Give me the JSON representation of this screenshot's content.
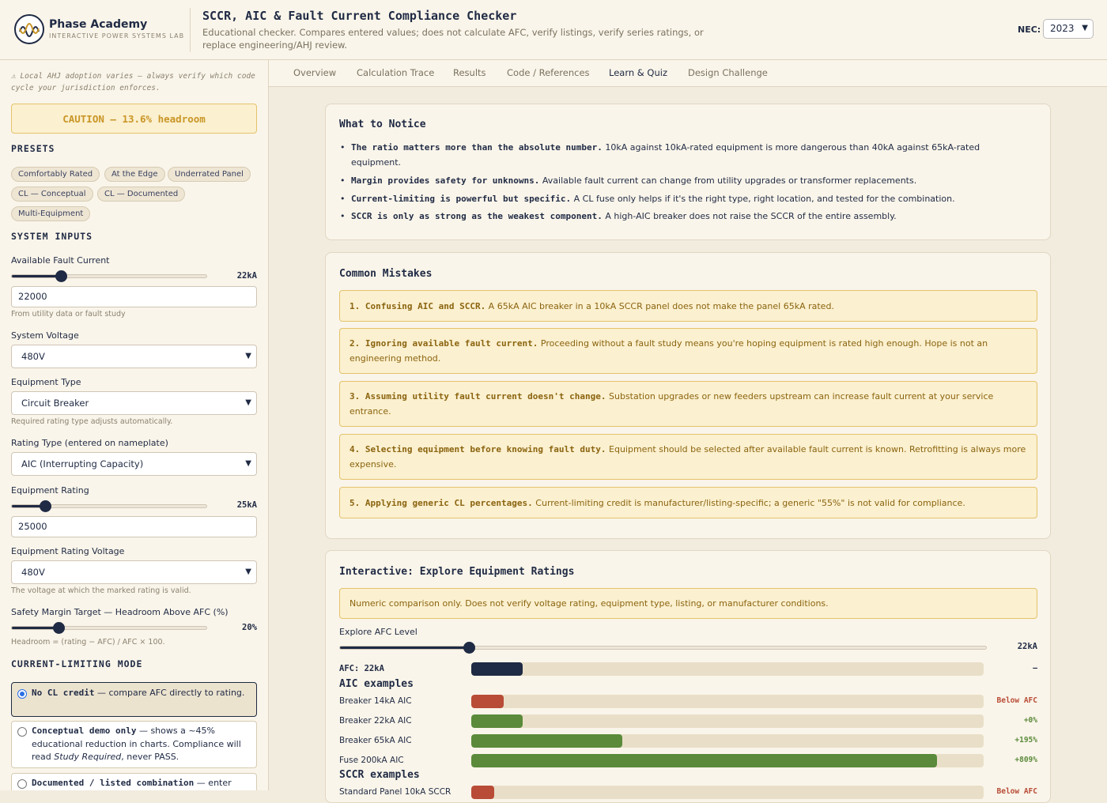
{
  "header": {
    "brand_name": "Phase Academy",
    "brand_sub": "INTERACTIVE POWER SYSTEMS LAB",
    "title": "SCCR, AIC & Fault Current Compliance Checker",
    "description": "Educational checker. Compares entered values; does not calculate AFC, verify listings, verify series ratings, or replace engineering/AHJ review.",
    "nec_label": "NEC:",
    "nec_value": "2023"
  },
  "sidebar": {
    "note": "⚠ Local AHJ adoption varies — always verify which code cycle your jurisdiction enforces.",
    "status": "CAUTION — 13.6% headroom",
    "presets_heading": "PRESETS",
    "presets": [
      "Comfortably Rated",
      "At the Edge",
      "Underrated Panel",
      "CL — Conceptual",
      "CL — Documented",
      "Multi-Equipment"
    ],
    "system_heading": "SYSTEM INPUTS",
    "afc_label": "Available Fault Current",
    "afc_display": "22kA",
    "afc_fraction": 0.25,
    "afc_input": "22000",
    "afc_hint": "From utility data or fault study",
    "voltage_label": "System Voltage",
    "voltage_value": "480V",
    "equip_type_label": "Equipment Type",
    "equip_type_value": "Circuit Breaker",
    "equip_type_hint": "Required rating type adjusts automatically.",
    "rating_type_label": "Rating Type (entered on nameplate)",
    "rating_type_value": "AIC (Interrupting Capacity)",
    "equip_rating_label": "Equipment Rating",
    "equip_rating_display": "25kA",
    "equip_rating_fraction": 0.17,
    "equip_rating_input": "25000",
    "rating_voltage_label": "Equipment Rating Voltage",
    "rating_voltage_value": "480V",
    "rating_voltage_hint": "The voltage at which the marked rating is valid.",
    "margin_label": "Safety Margin Target — Headroom Above AFC (%)",
    "margin_display": "20%",
    "margin_fraction": 0.24,
    "margin_hint": "Headroom = (rating − AFC) / AFC × 100.",
    "cl_heading": "CURRENT-LIMITING MODE",
    "cl_options": [
      {
        "bold": "No CL credit",
        "rest": " — compare AFC directly to rating.",
        "selected": true
      },
      {
        "bold": "Conceptual demo only",
        "rest": " — shows a ~45% educational reduction in charts. Compliance will read ",
        "italic": "Study Required",
        "tail": ", never PASS.",
        "selected": false
      },
      {
        "bold": "Documented / listed combination",
        "rest": " — enter",
        "selected": false
      }
    ]
  },
  "tabs": [
    "Overview",
    "Calculation Trace",
    "Results",
    "Code / References",
    "Learn & Quiz",
    "Design Challenge"
  ],
  "active_tab": "Learn & Quiz",
  "notice": {
    "title": "What to Notice",
    "items": [
      {
        "bold": "The ratio matters more than the absolute number.",
        "text": " 10kA against 10kA-rated equipment is more dangerous than 40kA against 65kA-rated equipment."
      },
      {
        "bold": "Margin provides safety for unknowns.",
        "text": " Available fault current can change from utility upgrades or transformer replacements."
      },
      {
        "bold": "Current-limiting is powerful but specific.",
        "text": " A CL fuse only helps if it's the right type, right location, and tested for the combination."
      },
      {
        "bold": "SCCR is only as strong as the weakest component.",
        "text": " A high-AIC breaker does not raise the SCCR of the entire assembly."
      }
    ]
  },
  "mistakes": {
    "title": "Common Mistakes",
    "items": [
      {
        "bold": "1. Confusing AIC and SCCR.",
        "text": " A 65kA AIC breaker in a 10kA SCCR panel does not make the panel 65kA rated."
      },
      {
        "bold": "2. Ignoring available fault current.",
        "text": " Proceeding without a fault study means you're hoping equipment is rated high enough. Hope is not an engineering method."
      },
      {
        "bold": "3. Assuming utility fault current doesn't change.",
        "text": " Substation upgrades or new feeders upstream can increase fault current at your service entrance."
      },
      {
        "bold": "4. Selecting equipment before knowing fault duty.",
        "text": " Equipment should be selected after available fault current is known. Retrofitting is always more expensive."
      },
      {
        "bold": "5. Applying generic CL percentages.",
        "text": " Current-limiting credit is manufacturer/listing-specific; a generic \"55%\" is not valid for compliance."
      }
    ]
  },
  "explore": {
    "title": "Interactive: Explore Equipment Ratings",
    "note": "Numeric comparison only. Does not verify voltage rating, equipment type, listing, or manufacturer conditions.",
    "slider_label": "Explore AFC Level",
    "slider_display": "22kA",
    "slider_fraction": 0.2,
    "afc_row": {
      "label": "AFC: 22kA",
      "value": 22,
      "pct": "—"
    },
    "scale_max_kA": 220,
    "aic_heading": "AIC examples",
    "aic_rows": [
      {
        "label": "Breaker 14kA AIC",
        "value": 14,
        "pct": "Below AFC",
        "status": "below"
      },
      {
        "label": "Breaker 22kA AIC",
        "value": 22,
        "pct": "+0%",
        "status": "ok"
      },
      {
        "label": "Breaker 65kA AIC",
        "value": 65,
        "pct": "+195%",
        "status": "ok"
      },
      {
        "label": "Fuse 200kA AIC",
        "value": 200,
        "pct": "+809%",
        "status": "ok"
      }
    ],
    "sccr_heading": "SCCR examples",
    "sccr_rows": [
      {
        "label": "Standard Panel 10kA SCCR",
        "value": 10,
        "pct": "Below AFC",
        "status": "below"
      }
    ]
  },
  "colors": {
    "navy": "#1f2a44",
    "ok": "#5a8a3a",
    "below": "#b84c36",
    "caution": "#c99627"
  }
}
